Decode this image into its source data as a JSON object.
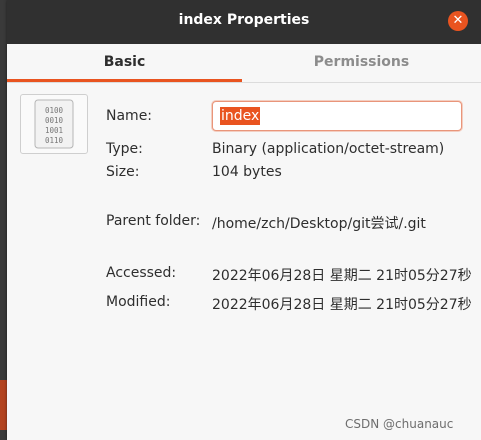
{
  "window": {
    "title": "index Properties",
    "close_glyph": "✕"
  },
  "tabs": [
    {
      "label": "Basic",
      "active": true
    },
    {
      "label": "Permissions",
      "active": false
    }
  ],
  "icon": {
    "name": "binary-file-icon",
    "lines": [
      "0100",
      "0010",
      "1001",
      "0110"
    ]
  },
  "properties": {
    "name_label": "Name:",
    "name_value": "index",
    "type_label": "Type:",
    "type_value": "Binary (application/octet-stream)",
    "size_label": "Size:",
    "size_value": "104 bytes",
    "parent_label": "Parent folder:",
    "parent_value": "/home/zch/Desktop/git尝试/.git",
    "accessed_label": "Accessed:",
    "accessed_value": "2022年06月28日 星期二 21时05分27秒",
    "modified_label": "Modified:",
    "modified_value": "2022年06月28日 星期二 21时05分27秒"
  },
  "watermark": "CSDN @chuanauc",
  "colors": {
    "accent": "#e95420",
    "titlebar": "#303030",
    "background": "#f7f7f7"
  }
}
